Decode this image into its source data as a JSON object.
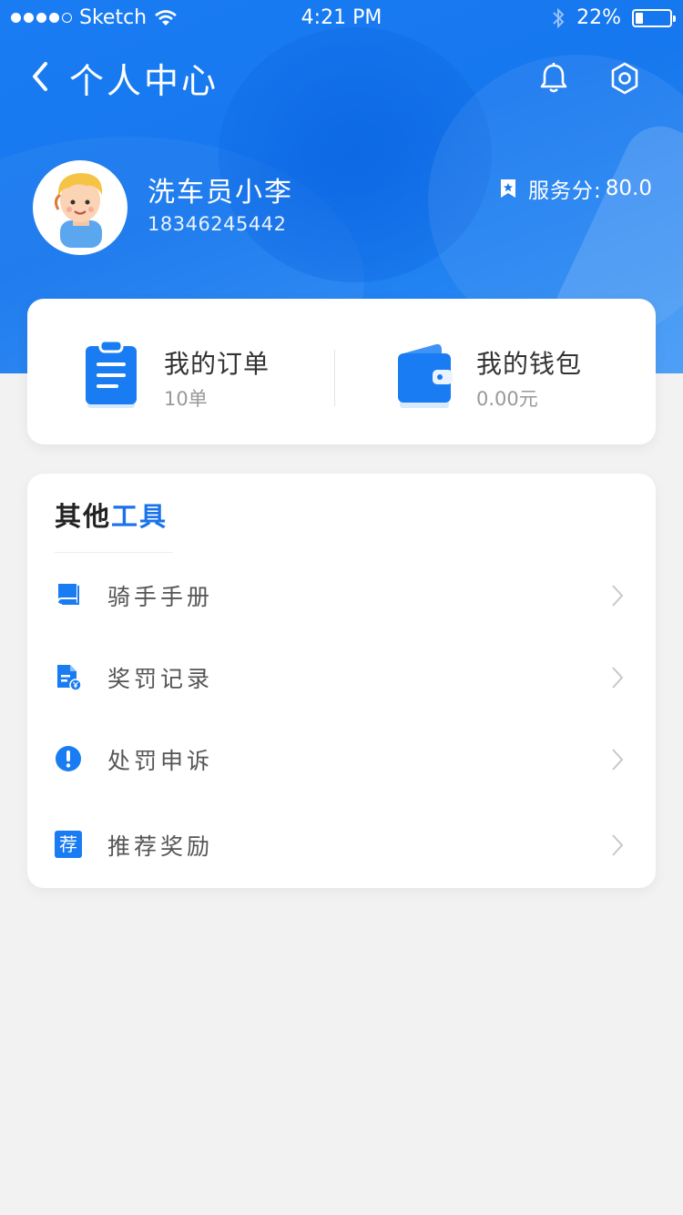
{
  "status_bar": {
    "carrier": "Sketch",
    "time": "4:21 PM",
    "battery_text": "22%",
    "battery_level": 0.22
  },
  "nav": {
    "title": "个人中心",
    "back_icon": "chevron-left-icon",
    "notification_icon": "bell-icon",
    "settings_icon": "gear-icon"
  },
  "profile": {
    "name": "洗车员小李",
    "phone": "18346245442",
    "score_label": "服务分:",
    "score_value": "80.0"
  },
  "stats": {
    "orders": {
      "label": "我的订单",
      "value": "10单",
      "icon": "clipboard-icon"
    },
    "wallet": {
      "label": "我的钱包",
      "value": "0.00元",
      "icon": "wallet-icon"
    }
  },
  "tools": {
    "title_part1": "其他",
    "title_part2": "工具",
    "items": [
      {
        "label": "骑手手册",
        "icon": "book-icon"
      },
      {
        "label": "奖罚记录",
        "icon": "document-yen-icon"
      },
      {
        "label": "处罚申诉",
        "icon": "exclamation-icon"
      },
      {
        "label": "推荐奖励",
        "icon": "recommend-icon",
        "icon_text": "荐"
      }
    ]
  },
  "colors": {
    "primary": "#1677ee",
    "accent_text": "#1a73e8",
    "page_bg": "#f2f2f2"
  }
}
